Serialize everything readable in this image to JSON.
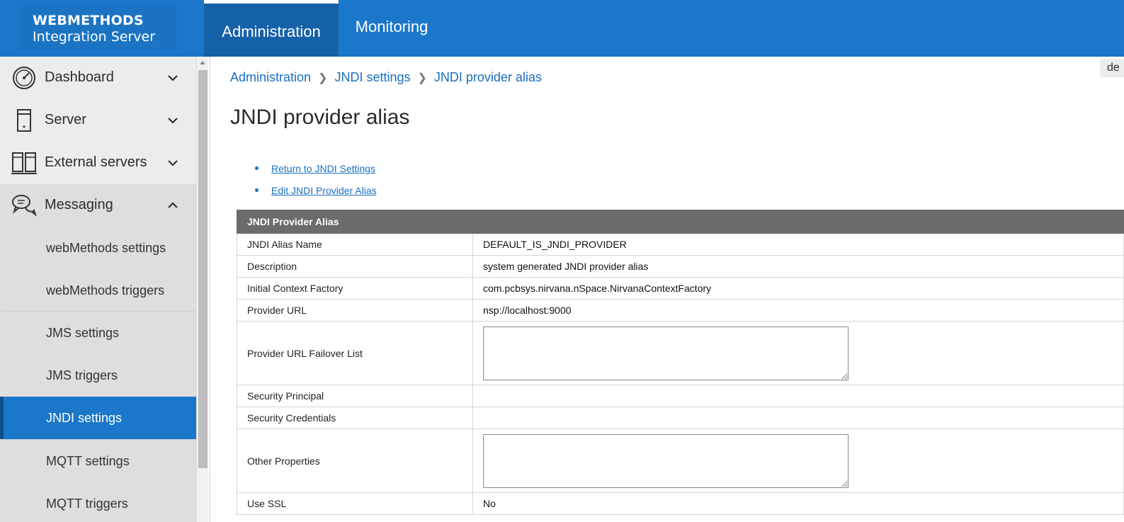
{
  "header": {
    "logo_line1": "WEBMETHODS",
    "logo_line2": "Integration Server",
    "tabs": [
      {
        "label": "Administration",
        "active": true
      },
      {
        "label": "Monitoring",
        "active": false
      }
    ],
    "accent_color": "#1a77c9"
  },
  "sidebar": {
    "items": [
      {
        "label": "Dashboard",
        "icon": "gauge-icon",
        "expanded": false
      },
      {
        "label": "Server",
        "icon": "server-icon",
        "expanded": false
      },
      {
        "label": "External servers",
        "icon": "server-rack-icon",
        "expanded": false
      },
      {
        "label": "Messaging",
        "icon": "chat-bubbles-icon",
        "expanded": true
      }
    ],
    "sub_items": [
      {
        "label": "webMethods settings",
        "active": false
      },
      {
        "label": "webMethods triggers",
        "active": false
      },
      {
        "label": "JMS settings",
        "active": false
      },
      {
        "label": "JMS triggers",
        "active": false
      },
      {
        "label": "JNDI settings",
        "active": true
      },
      {
        "label": "MQTT settings",
        "active": false
      },
      {
        "label": "MQTT triggers",
        "active": false
      }
    ]
  },
  "breadcrumb": [
    "Administration",
    "JNDI settings",
    "JNDI provider alias"
  ],
  "page_title": "JNDI provider alias",
  "corner_tag": "de",
  "links": [
    {
      "label": "Return to JNDI Settings"
    },
    {
      "label": "Edit JNDI Provider Alias"
    }
  ],
  "table": {
    "header": "JNDI Provider Alias",
    "rows": [
      {
        "label": "JNDI Alias Name",
        "value": "DEFAULT_IS_JNDI_PROVIDER"
      },
      {
        "label": "Description",
        "value": "system generated JNDI provider alias"
      },
      {
        "label": "Initial Context Factory",
        "value": "com.pcbsys.nirvana.nSpace.NirvanaContextFactory"
      },
      {
        "label": "Provider URL",
        "value": "nsp://localhost:9000"
      },
      {
        "label": "Provider URL Failover List",
        "value": ""
      },
      {
        "label": "Security Principal",
        "value": ""
      },
      {
        "label": "Security Credentials",
        "value": ""
      },
      {
        "label": "Other Properties",
        "value": ""
      },
      {
        "label": "Use SSL",
        "value": "No"
      }
    ]
  }
}
